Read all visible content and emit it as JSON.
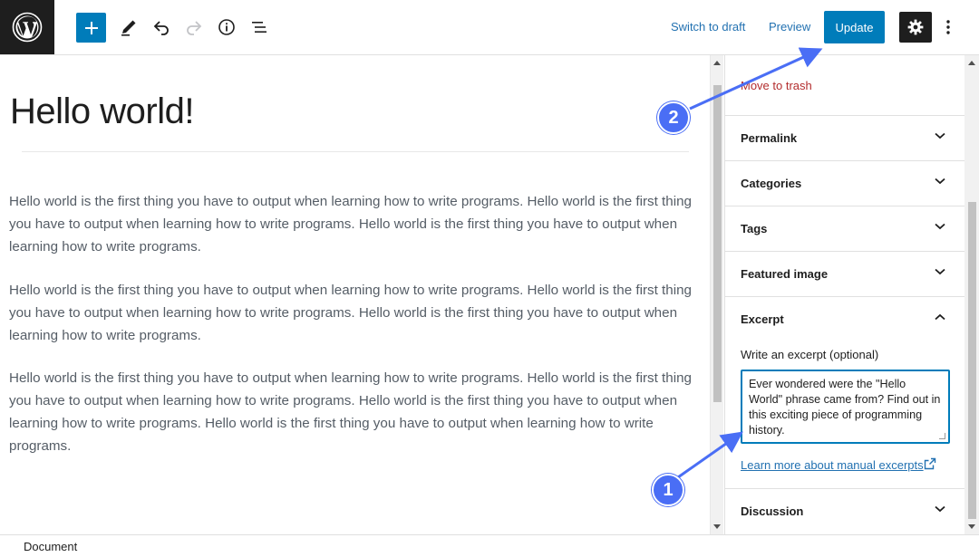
{
  "toolbar": {
    "switch_to_draft": "Switch to draft",
    "preview": "Preview",
    "update": "Update",
    "icons": [
      "wordpress-logo",
      "plus-icon",
      "pencil-icon",
      "undo-icon",
      "redo-icon",
      "info-icon",
      "list-view-icon",
      "gear-icon",
      "more-vertical-icon"
    ]
  },
  "post": {
    "title": "Hello world!",
    "paragraphs": [
      "Hello world is the first thing you have to output when learning how to write programs. Hello world is the first thing you have to output when learning how to write programs. Hello world is the first thing you have to output when learning how to write programs.",
      "Hello world is the first thing you have to output when learning how to write programs. Hello world is the first thing you have to output when learning how to write programs. Hello world is the first thing you have to output when learning how to write programs.",
      "Hello world is the first thing you have to output when learning how to write programs. Hello world is the first thing you have to output when learning how to write programs. Hello world is the first thing you have to output when learning how to write programs. Hello world is the first thing you have to output when learning how to write programs."
    ]
  },
  "sidebar": {
    "move_to_trash": "Move to trash",
    "panels": {
      "permalink": "Permalink",
      "categories": "Categories",
      "tags": "Tags",
      "featured_image": "Featured image",
      "excerpt": "Excerpt",
      "discussion": "Discussion"
    },
    "excerpt_label": "Write an excerpt (optional)",
    "excerpt_value": "Ever wondered were the \"Hello World\" phrase came from? Find out in this exciting piece of programming history.",
    "learn_more": "Learn more about manual excerpts"
  },
  "footer": {
    "breadcrumb": "Document"
  },
  "annotations": {
    "badge_1": "1",
    "badge_2": "2",
    "color": "#4a6ef5"
  },
  "colors": {
    "accent": "#007cba",
    "trash": "#b32d2e",
    "dark": "#1e1e1e"
  }
}
